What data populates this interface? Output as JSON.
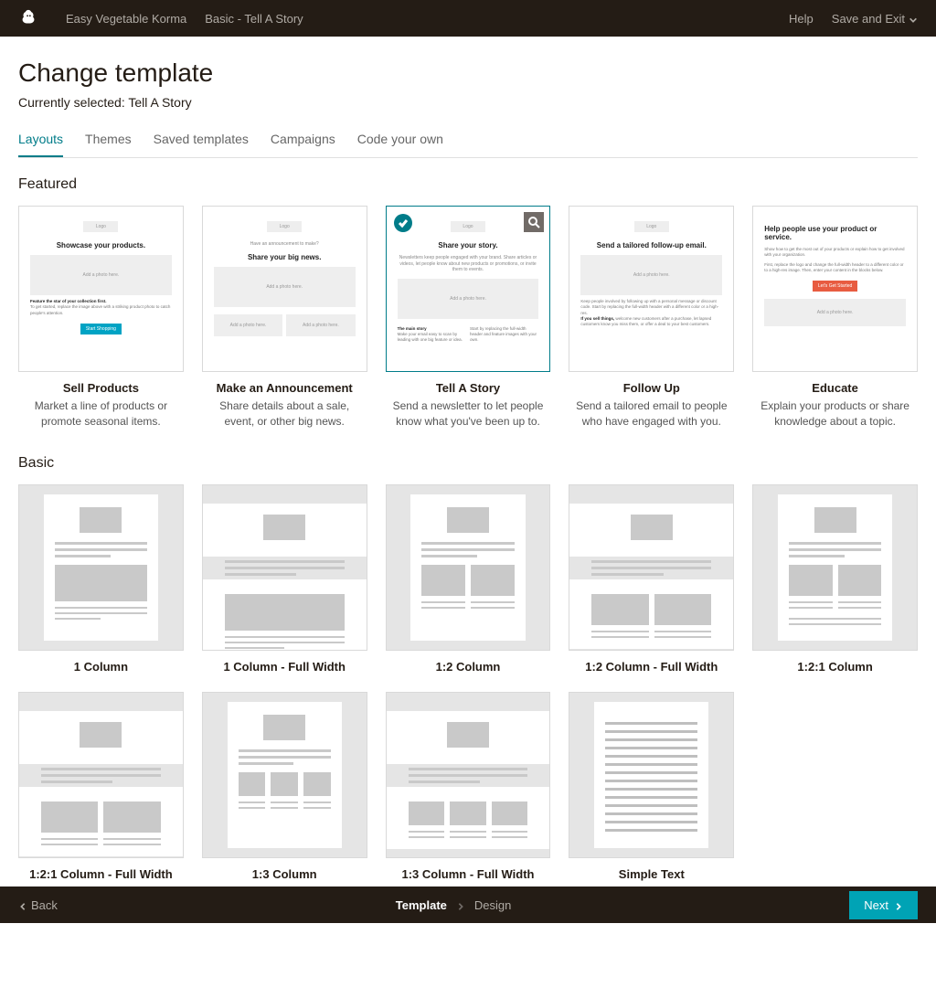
{
  "header": {
    "project": "Easy Vegetable Korma",
    "template": "Basic - Tell A Story",
    "help": "Help",
    "save": "Save and Exit"
  },
  "page": {
    "title": "Change template",
    "currently_label": "Currently selected:",
    "currently_value": "Tell A Story"
  },
  "tabs": [
    "Layouts",
    "Themes",
    "Saved templates",
    "Campaigns",
    "Code your own"
  ],
  "sections": {
    "featured": "Featured",
    "basic": "Basic"
  },
  "featured": [
    {
      "title": "Sell Products",
      "desc": "Market a line of products or promote seasonal items.",
      "selected": false,
      "heading": "Showcase your products.",
      "sub": "",
      "cta": "Start Shopping",
      "cta_color": "blue",
      "note": "Feature the star of your collection first."
    },
    {
      "title": "Make an Announcement",
      "desc": "Share details about a sale, event, or other big news.",
      "selected": false,
      "heading": "Share your big news.",
      "sub": "Have an announcement to make?",
      "row2": true
    },
    {
      "title": "Tell A Story",
      "desc": "Send a newsletter to let people know what you've been up to.",
      "selected": true,
      "heading": "Share your story.",
      "sub": "Newsletters keep people engaged with your brand. Share articles or videos, let people know about new products or promotions, or invite them to events.",
      "row2cols": true
    },
    {
      "title": "Follow Up",
      "desc": "Send a tailored email to people who have engaged with you.",
      "selected": false,
      "heading": "Send a tailored follow-up email.",
      "sub": "",
      "note": "Keep people involved by following up with a personal message or discount code."
    },
    {
      "title": "Educate",
      "desc": "Explain your products or share knowledge about a topic.",
      "selected": false,
      "heading": "Help people use your product or service.",
      "sub": "Show how to get the most out of your products or explain how to get involved with your organization.",
      "cta": "Let's Get Started",
      "cta_color": "red"
    }
  ],
  "basic": [
    {
      "title": "1 Column",
      "type": "1col"
    },
    {
      "title": "1 Column - Full Width",
      "type": "1col-full"
    },
    {
      "title": "1:2 Column",
      "type": "12col"
    },
    {
      "title": "1:2 Column - Full Width",
      "type": "12col-full"
    },
    {
      "title": "1:2:1 Column",
      "type": "121col"
    },
    {
      "title": "1:2:1 Column - Full Width",
      "type": "121col-full"
    },
    {
      "title": "1:3 Column",
      "type": "13col"
    },
    {
      "title": "1:3 Column - Full Width",
      "type": "13col-full"
    },
    {
      "title": "Simple Text",
      "type": "simple"
    }
  ],
  "footer": {
    "back": "Back",
    "step1": "Template",
    "step2": "Design",
    "next": "Next"
  },
  "placeholders": {
    "logo": "Logo",
    "addphoto": "Add a photo here."
  }
}
